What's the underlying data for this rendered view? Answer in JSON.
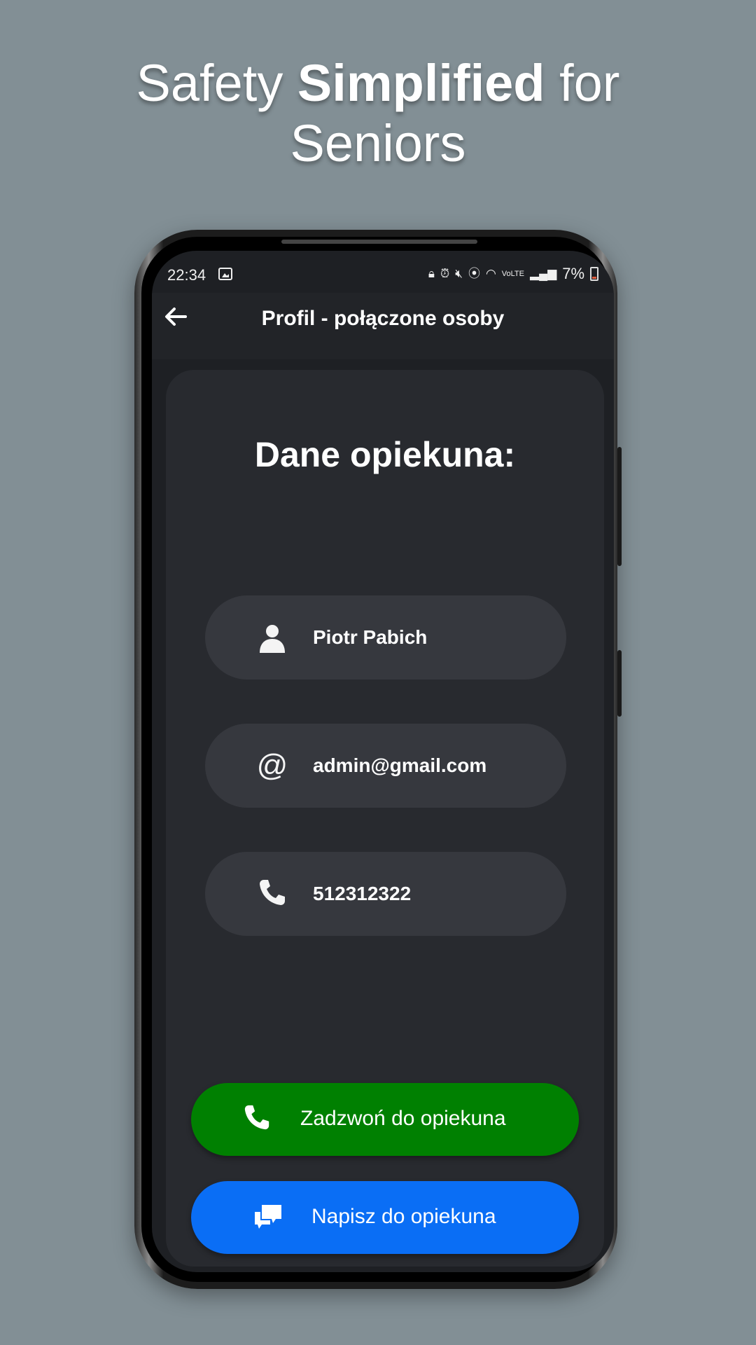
{
  "promo": {
    "headline_pre": "Safety ",
    "headline_bold": "Simplified",
    "headline_post": " for",
    "headline_line2": "Seniors"
  },
  "status_bar": {
    "time": "22:34",
    "battery": "7%",
    "icons": [
      "image-icon",
      "lock-icon",
      "alarm-icon",
      "mute-icon",
      "location-icon",
      "wifi-icon",
      "volte-icon",
      "signal-icon",
      "battery-icon"
    ]
  },
  "app_bar": {
    "title": "Profil - połączone osoby",
    "back_icon": "arrow-left-icon"
  },
  "caregiver": {
    "title": "Dane opiekuna:",
    "name": "Piotr Pabich",
    "email": "admin@gmail.com",
    "phone": "512312322"
  },
  "actions": {
    "call_label": "Zadzwoń do opiekuna",
    "message_label": "Napisz do opiekuna"
  },
  "colors": {
    "background": "#828f95",
    "screen": "#1e2024",
    "card": "#282a2f",
    "field": "#36383e",
    "call_button": "#008001",
    "message_button": "#0a6ef5"
  }
}
